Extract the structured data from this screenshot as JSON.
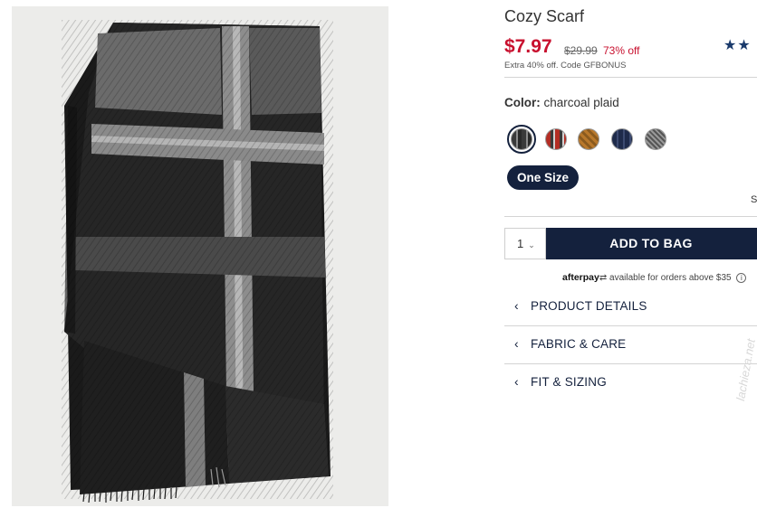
{
  "product": {
    "title": "Cozy Scarf",
    "sale_price": "$7.97",
    "original_price": "$29.99",
    "discount": "73% off",
    "promo": "Extra 40% off. Code GFBONUS",
    "stars": "★★"
  },
  "color": {
    "label": "Color:",
    "value": "charcoal plaid",
    "swatches": [
      "charcoal plaid",
      "red plaid",
      "camel",
      "navy",
      "grey"
    ]
  },
  "size": {
    "selected": "One Size",
    "chart_partial": "S"
  },
  "purchase": {
    "quantity": "1",
    "add_to_bag": "ADD TO BAG"
  },
  "afterpay": {
    "brand": "afterpay",
    "text": "available for orders above $35",
    "info_glyph": "i"
  },
  "accordion": [
    {
      "label": "PRODUCT DETAILS"
    },
    {
      "label": "FABRIC & CARE"
    },
    {
      "label": "FIT & SIZING"
    }
  ],
  "watermark": "lachieza.net",
  "colors": {
    "brand_navy": "#14213d",
    "sale_red": "#c8102e"
  }
}
